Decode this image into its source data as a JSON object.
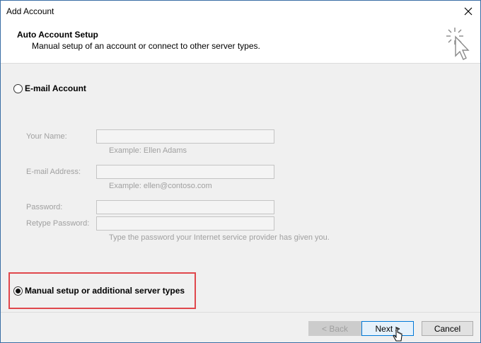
{
  "window": {
    "title": "Add Account"
  },
  "header": {
    "title": "Auto Account Setup",
    "subtitle": "Manual setup of an account or connect to other server types."
  },
  "options": {
    "email_account": {
      "label": "E-mail Account",
      "checked": false
    },
    "manual_setup": {
      "label": "Manual setup or additional server types",
      "checked": true
    }
  },
  "fields": {
    "your_name": {
      "label": "Your Name:",
      "value": "",
      "hint": "Example: Ellen Adams"
    },
    "email_address": {
      "label": "E-mail Address:",
      "value": "",
      "hint": "Example: ellen@contoso.com"
    },
    "password": {
      "label": "Password:",
      "value": ""
    },
    "retype_password": {
      "label": "Retype Password:",
      "value": "",
      "hint": "Type the password your Internet service provider has given you."
    }
  },
  "buttons": {
    "back": "< Back",
    "next": "Next >",
    "cancel": "Cancel"
  },
  "icons": {
    "close": "close-icon",
    "wizard": "cursor-sparkle-icon",
    "mouse_pointer": "mouse-pointer-icon"
  },
  "colors": {
    "highlight": "#e0474c",
    "primary_border": "#0078d7"
  }
}
